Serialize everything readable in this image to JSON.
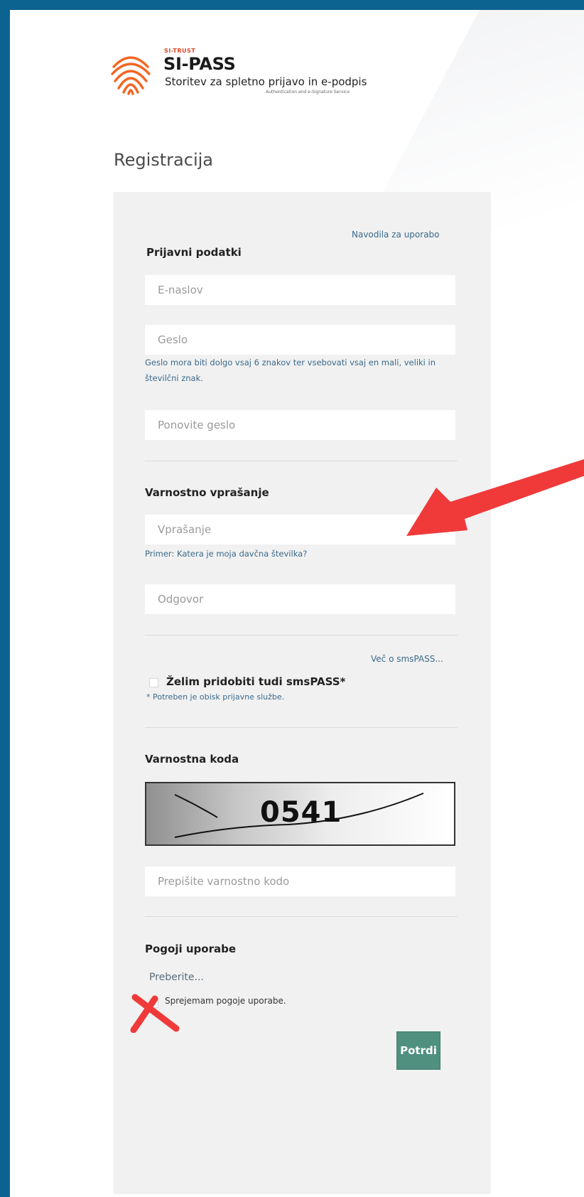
{
  "header": {
    "brand_small": "SI-TRUST",
    "brand_title": "SI-PASS",
    "brand_subtitle": "Storitev za spletno prijavo in e-podpis",
    "brand_subtitle_en": "Authentication and e-Signature Service",
    "logo_color": "#f26522"
  },
  "page_title": "Registracija",
  "form": {
    "help_link": "Navodila za uporabo",
    "login_section": "Prijavni podatki",
    "email_placeholder": "E-naslov",
    "password_placeholder": "Geslo",
    "password_hint": "Geslo mora biti dolgo vsaj 6 znakov ter vsebovati vsaj en mali, veliki in številčni znak.",
    "repeat_password_placeholder": "Ponovite geslo",
    "security_question_section": "Varnostno vprašanje",
    "question_placeholder": "Vprašanje",
    "question_hint": "Primer: Katera je moja davčna številka?",
    "answer_placeholder": "Odgovor",
    "smspass_link": "Več o smsPASS...",
    "smspass_checkbox_label": "Želim pridobiti tudi smsPASS*",
    "smspass_note": "* Potreben je obisk prijavne službe.",
    "captcha_section": "Varnostna koda",
    "captcha_code": "0541",
    "captcha_placeholder": "Prepišite varnostno kodo",
    "terms_section": "Pogoji uporabe",
    "terms_link": "Preberite...",
    "terms_checkbox_label": "Sprejemam pogoje uporabe.",
    "submit_label": "Potrdi",
    "accent_color": "#4f907f"
  },
  "annotations": {
    "arrow_color": "#f03a3a",
    "cross_color": "#f03a3a"
  }
}
